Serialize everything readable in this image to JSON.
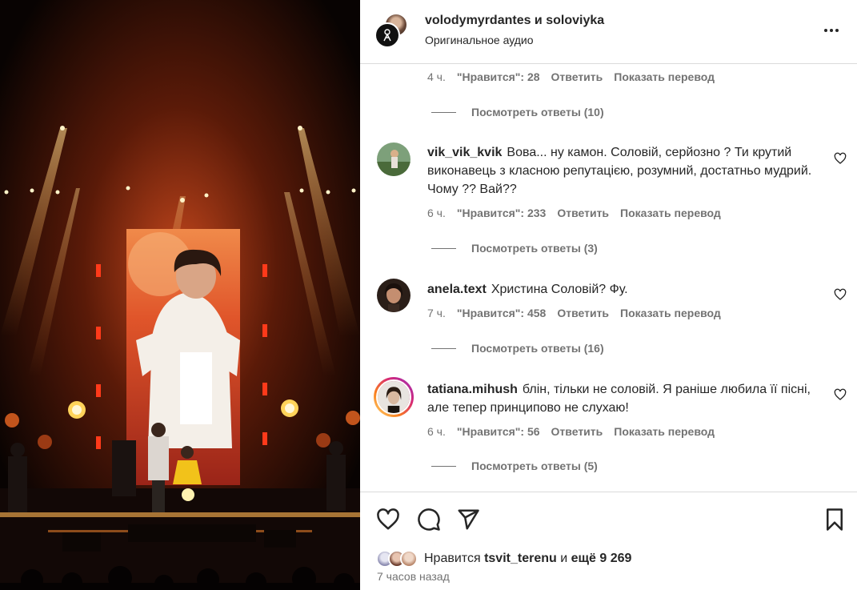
{
  "header": {
    "title": "volodymyrdantes и soloviyka",
    "audio": "Оригинальное аудио"
  },
  "comments": [
    {
      "user": "",
      "text": "",
      "time": "4 ч.",
      "likes": "\"Нравится\": 28",
      "reply": "Ответить",
      "translate": "Показать перевод",
      "view_replies": "Посмотреть ответы (10)"
    },
    {
      "user": "vik_vik_kvik",
      "text": "Вова... ну камон. Соловій, серйозно ? Ти крутий виконавець з класною репутацією, розумний, достатньо мудрий. Чому ?? Вай??",
      "time": "6 ч.",
      "likes": "\"Нравится\": 233",
      "reply": "Ответить",
      "translate": "Показать перевод",
      "view_replies": "Посмотреть ответы (3)"
    },
    {
      "user": "anela.text",
      "text": "Христина Соловій? Фу.",
      "time": "7 ч.",
      "likes": "\"Нравится\": 458",
      "reply": "Ответить",
      "translate": "Показать перевод",
      "view_replies": "Посмотреть ответы (16)"
    },
    {
      "user": "tatiana.mihush",
      "text": "блін, тільки не соловій. Я раніше любила її пісні, але тепер принципово не слухаю!",
      "time": "6 ч.",
      "likes": "\"Нравится\": 56",
      "reply": "Ответить",
      "translate": "Показать перевод",
      "view_replies": "Посмотреть ответы (5)"
    }
  ],
  "footer": {
    "likes_prefix": "Нравится",
    "likes_user": "tsvit_terenu",
    "likes_and": "и",
    "likes_more": "ещё 9 269",
    "timestamp": "7 часов назад"
  },
  "icons": {
    "more": "more-horizontal-icon",
    "like": "heart-icon",
    "comment": "comment-icon",
    "share": "share-icon",
    "save": "bookmark-icon"
  }
}
